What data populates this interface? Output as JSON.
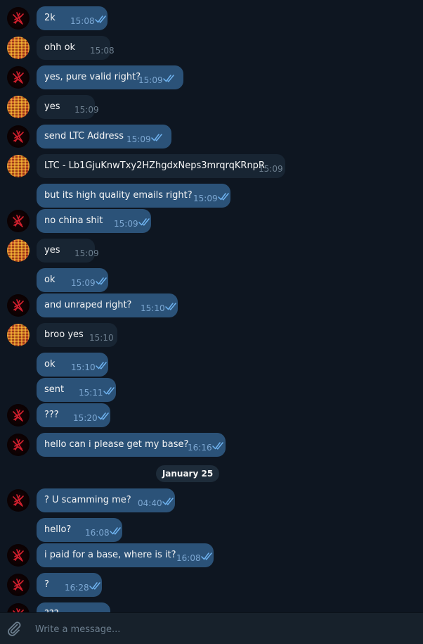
{
  "messages": [
    {
      "dir": "out",
      "avatar": "me",
      "text": "2k",
      "time": "15:08"
    },
    {
      "dir": "in",
      "avatar": "other",
      "text": "ohh ok",
      "time": "15:08"
    },
    {
      "dir": "out",
      "avatar": "me",
      "text": "yes, pure valid right?",
      "time": "15:09"
    },
    {
      "dir": "in",
      "avatar": "other",
      "text": "yes",
      "time": "15:09"
    },
    {
      "dir": "out",
      "avatar": "me",
      "text": "send LTC Address",
      "time": "15:09"
    },
    {
      "dir": "in",
      "avatar": "other",
      "text": "LTC - Lb1GjuKnwTxy2HZhgdxNeps3mrqrqKRnpR",
      "time": "15:09"
    },
    {
      "dir": "out",
      "avatar": "",
      "text": "but its high quality emails right?",
      "time": "15:09"
    },
    {
      "dir": "out",
      "avatar": "me",
      "text": "no china shit",
      "time": "15:09"
    },
    {
      "dir": "in",
      "avatar": "other",
      "text": "yes",
      "time": "15:09"
    },
    {
      "dir": "out",
      "avatar": "",
      "text": "ok",
      "time": "15:09"
    },
    {
      "dir": "out",
      "avatar": "me",
      "text": "and unraped right?",
      "time": "15:10"
    },
    {
      "dir": "in",
      "avatar": "other",
      "text": "broo yes",
      "time": "15:10"
    },
    {
      "dir": "out",
      "avatar": "",
      "text": "ok",
      "time": "15:10"
    },
    {
      "dir": "out",
      "avatar": "",
      "text": "sent",
      "time": "15:11"
    },
    {
      "dir": "out",
      "avatar": "me",
      "text": "???",
      "time": "15:20"
    },
    {
      "dir": "out",
      "avatar": "me",
      "text": "hello can i please get my base?",
      "time": "16:16"
    },
    {
      "dir": "out",
      "avatar": "me",
      "text": "? U scamming me?",
      "time": "04:40"
    },
    {
      "dir": "out",
      "avatar": "",
      "text": "hello?",
      "time": "16:08"
    },
    {
      "dir": "out",
      "avatar": "me",
      "text": "i paid for a base, where is it?",
      "time": "16:08"
    },
    {
      "dir": "out",
      "avatar": "me",
      "text": "?",
      "time": "16:28"
    },
    {
      "dir": "out",
      "avatar": "me",
      "text": "???",
      "time": ""
    }
  ],
  "date_separator": "January 25",
  "composer": {
    "placeholder": "Write a message..."
  },
  "colors": {
    "background": "#0e1621",
    "outgoing": "#2b5278",
    "incoming": "#182533",
    "tick": "#6fb3f0"
  },
  "icons": {
    "attach": "paperclip-icon",
    "read": "double-check-icon"
  }
}
